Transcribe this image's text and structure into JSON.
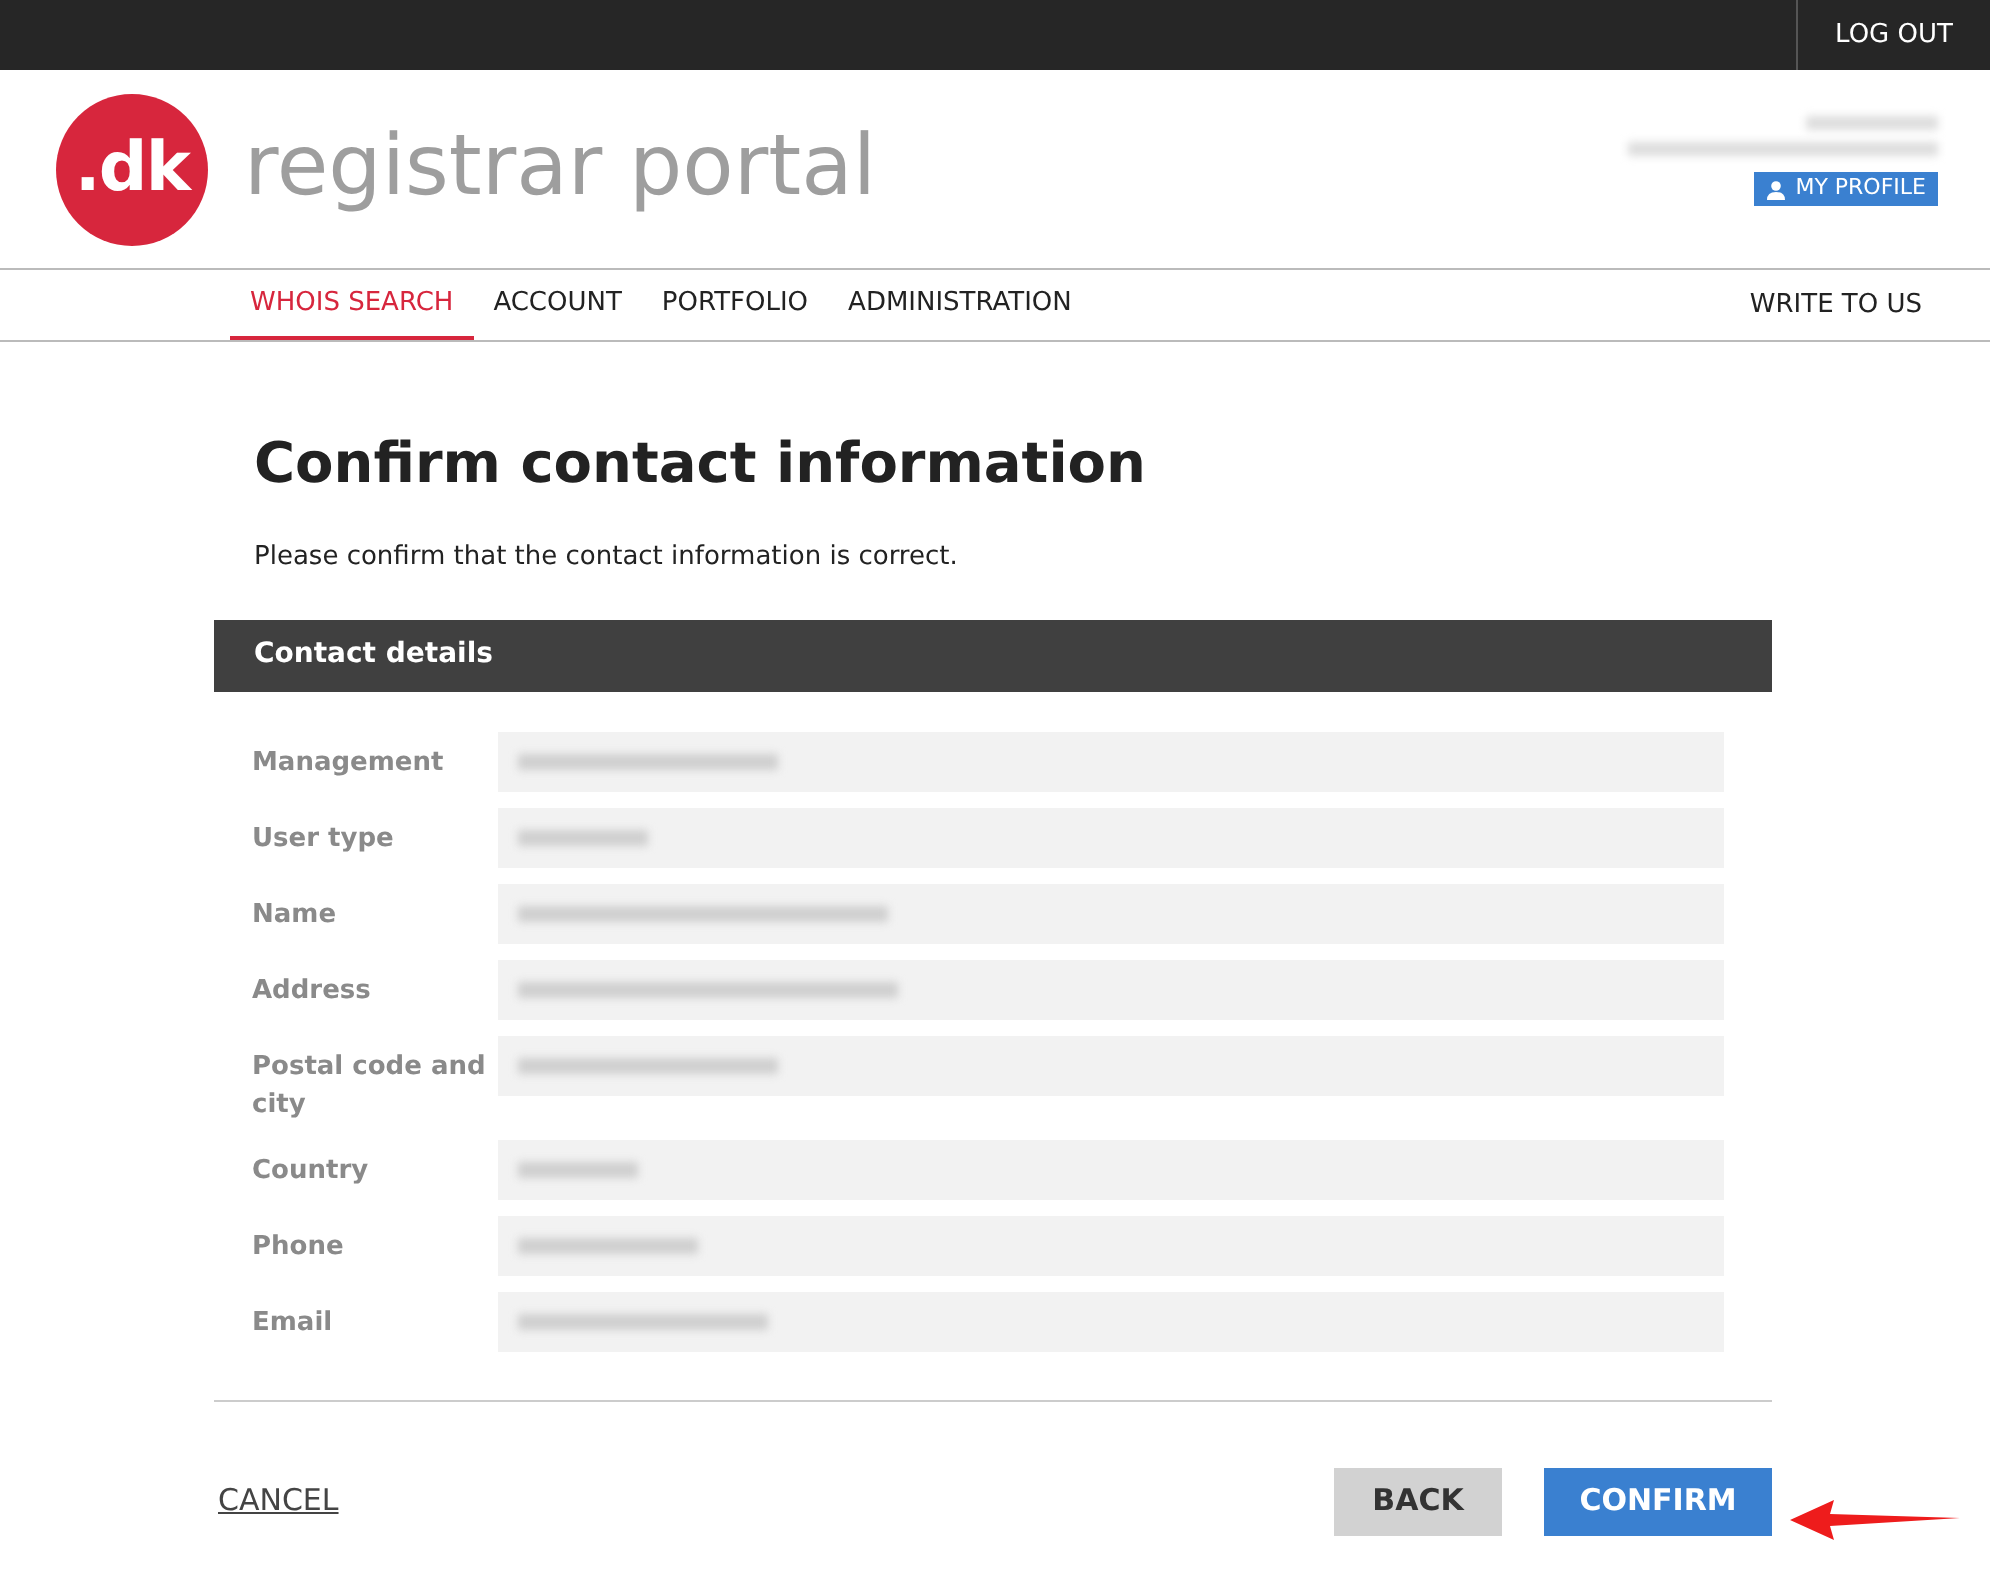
{
  "top_bar": {
    "logout": "LOG OUT"
  },
  "header": {
    "logo_text": ".dk",
    "portal_name": "registrar portal",
    "profile_button": "MY PROFILE"
  },
  "nav": {
    "items": [
      {
        "label": "WHOIS SEARCH",
        "selected": true
      },
      {
        "label": "ACCOUNT",
        "selected": false
      },
      {
        "label": "PORTFOLIO",
        "selected": false
      },
      {
        "label": "ADMINISTRATION",
        "selected": false
      }
    ],
    "right_link": "WRITE TO US"
  },
  "page": {
    "title": "Confirm contact information",
    "intro": "Please confirm that the contact information is correct."
  },
  "contact_details": {
    "heading": "Contact details",
    "rows": [
      {
        "label": "Management"
      },
      {
        "label": "User type"
      },
      {
        "label": "Name"
      },
      {
        "label": "Address"
      },
      {
        "label": "Postal code and city"
      },
      {
        "label": "Country"
      },
      {
        "label": "Phone"
      },
      {
        "label": "Email"
      }
    ]
  },
  "actions": {
    "cancel": "CANCEL",
    "back": "BACK",
    "confirm": "CONFIRM"
  }
}
